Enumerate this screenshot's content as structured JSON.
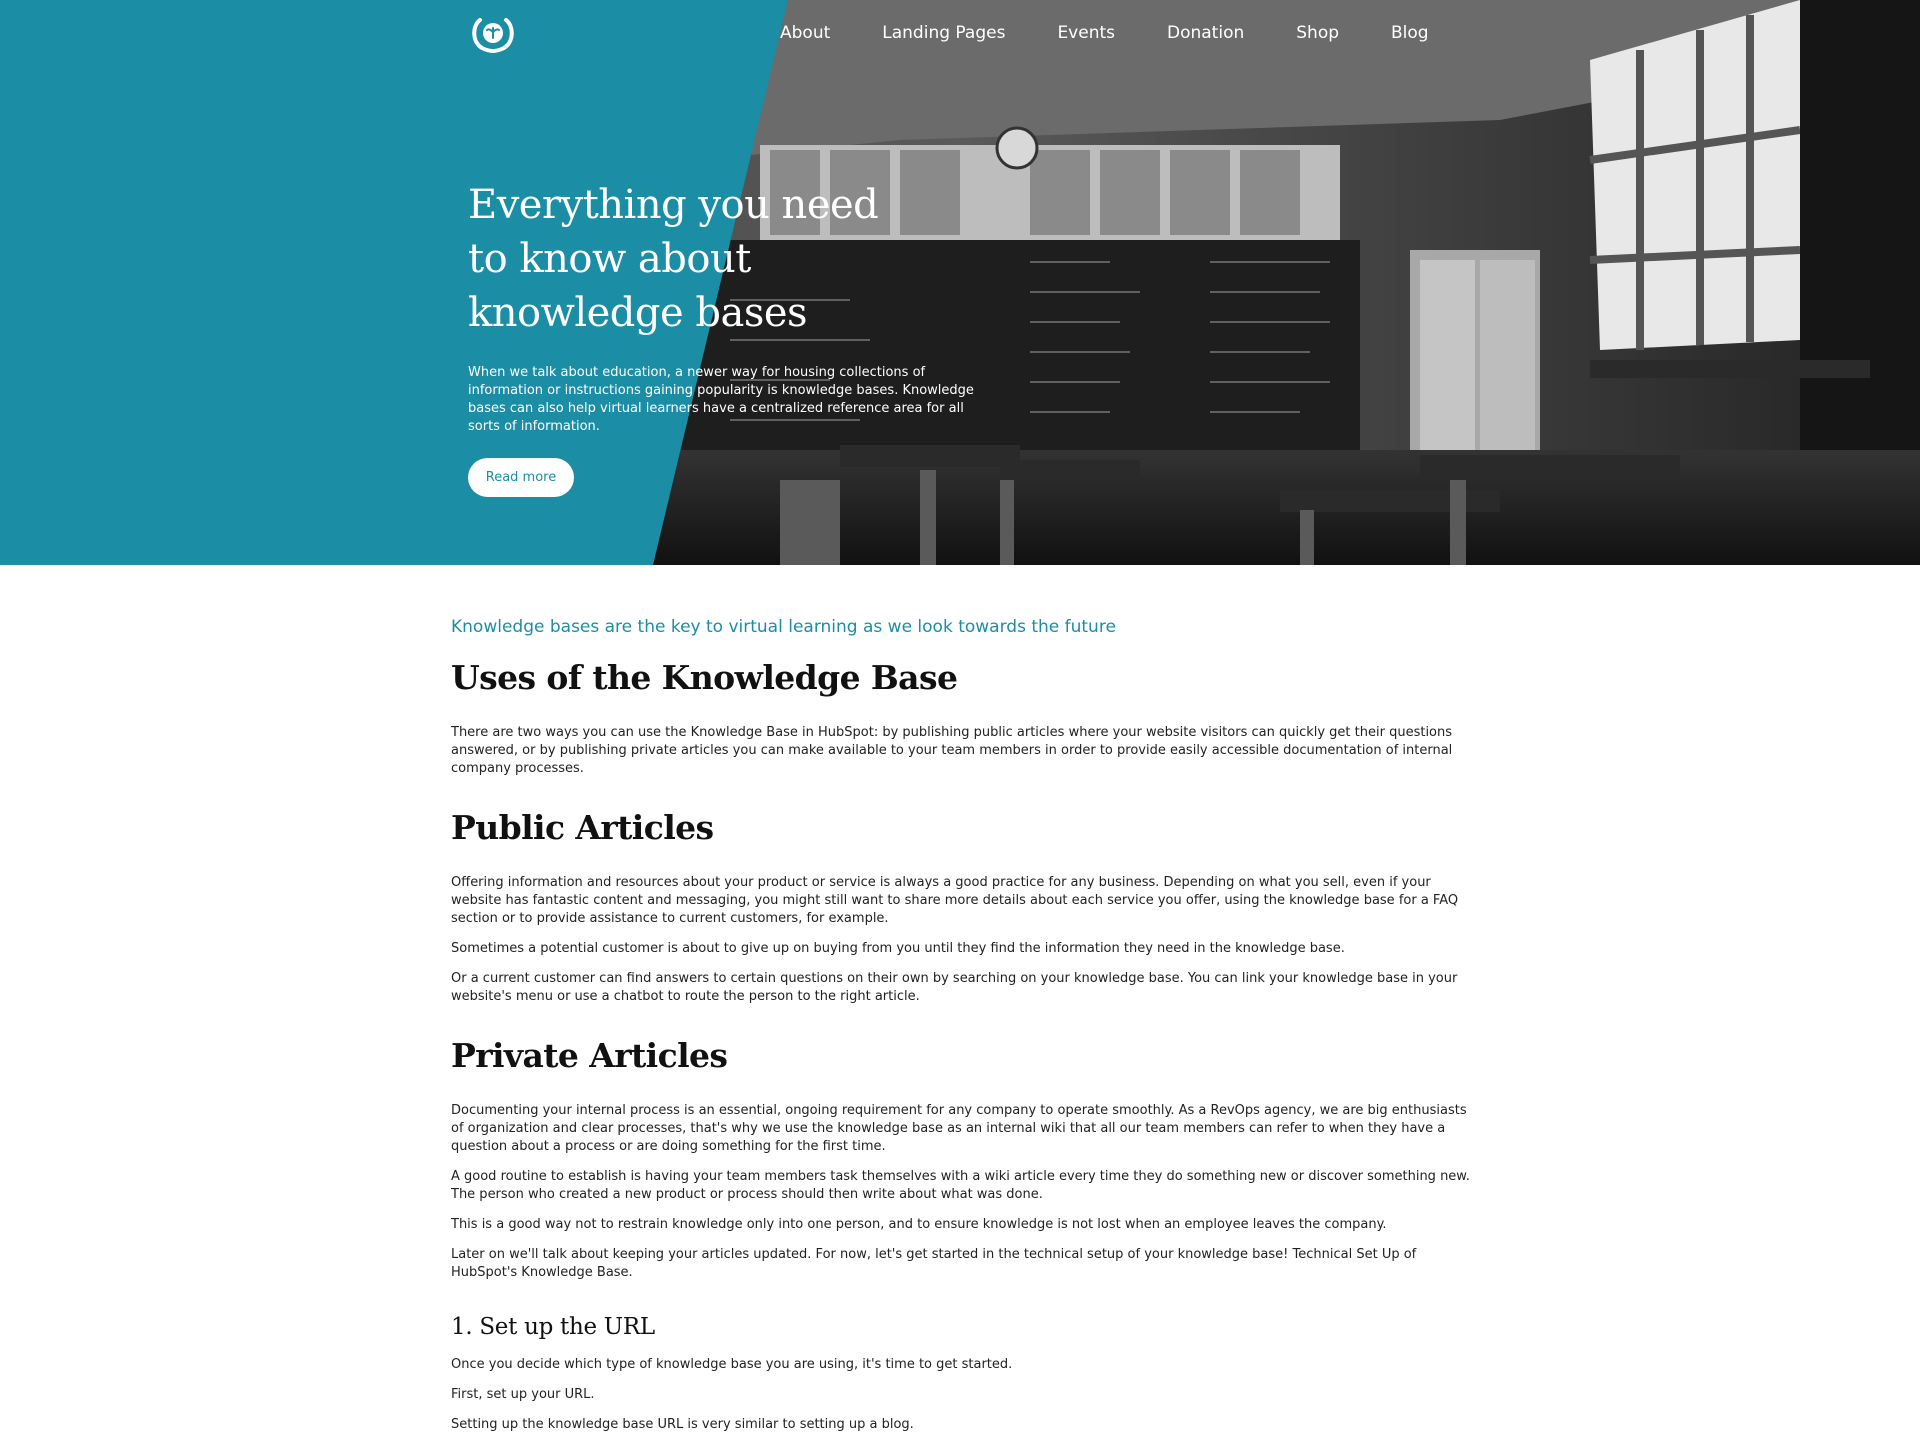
{
  "nav": {
    "logo_label": "",
    "items": [
      "About",
      "Landing Pages",
      "Events",
      "Donation",
      "Shop",
      "Blog"
    ]
  },
  "hero": {
    "title": "Everything you need to know about knowledge bases",
    "description": "When we talk about education, a newer way for housing collections of information or instructions gaining popularity is knowledge bases. Knowledge bases can also help virtual learners have a centralized reference area for all sorts of information.",
    "button_label": "Read more",
    "photo_icon": "classroom-photo",
    "accent_color": "#1b8ea6"
  },
  "article": {
    "lead": "Knowledge bases are the key to virtual learning as we look towards the future",
    "sections": [
      {
        "heading": "Uses of the Knowledge Base",
        "paragraphs": [
          "There are two ways you can use the Knowledge Base in HubSpot: by publishing public articles where your website visitors can quickly get their questions answered, or by publishing private articles you can make available to your team members in order to provide easily accessible documentation of internal company processes."
        ]
      },
      {
        "heading": "Public Articles",
        "paragraphs": [
          "Offering information and resources about your product or service is always a good practice for any business. Depending on what you sell, even if your website has fantastic content and messaging, you might still want to share more details about each service you offer, using the knowledge base for a FAQ section or to provide assistance to current customers, for example.",
          "Sometimes a potential customer is about to give up on buying from you until they find the information they need in the knowledge base.",
          "Or a current customer can find answers to certain questions on their own by searching on your knowledge base. You can link your knowledge base in your website's menu or use a chatbot to route the person to the right article."
        ]
      },
      {
        "heading": "Private Articles",
        "paragraphs": [
          "Documenting your internal process is an essential, ongoing requirement for any company to operate smoothly. As a RevOps agency, we are big enthusiasts of organization and clear processes, that's why we use the knowledge base as an internal wiki that all our team members can refer to when they have a question about a process or are doing something for the first time.",
          "A good routine to establish is having your team members task themselves with a wiki article every time they do something new or discover something new. The person who created a new product or process should then write about what was done.",
          "This is a good way not to restrain knowledge only into one person, and to ensure knowledge is not lost when an employee leaves the company.",
          "Later on we'll talk about keeping your articles updated. For now, let's get started in the technical setup of your knowledge base! Technical Set Up of HubSpot's Knowledge Base."
        ]
      },
      {
        "subheading": "1. Set up the URL",
        "paragraphs": [
          "Once you decide which type of knowledge base you are using, it's time to get started.",
          "First, set up your URL.",
          "Setting up the knowledge base URL is very similar to setting up a blog."
        ]
      }
    ]
  }
}
